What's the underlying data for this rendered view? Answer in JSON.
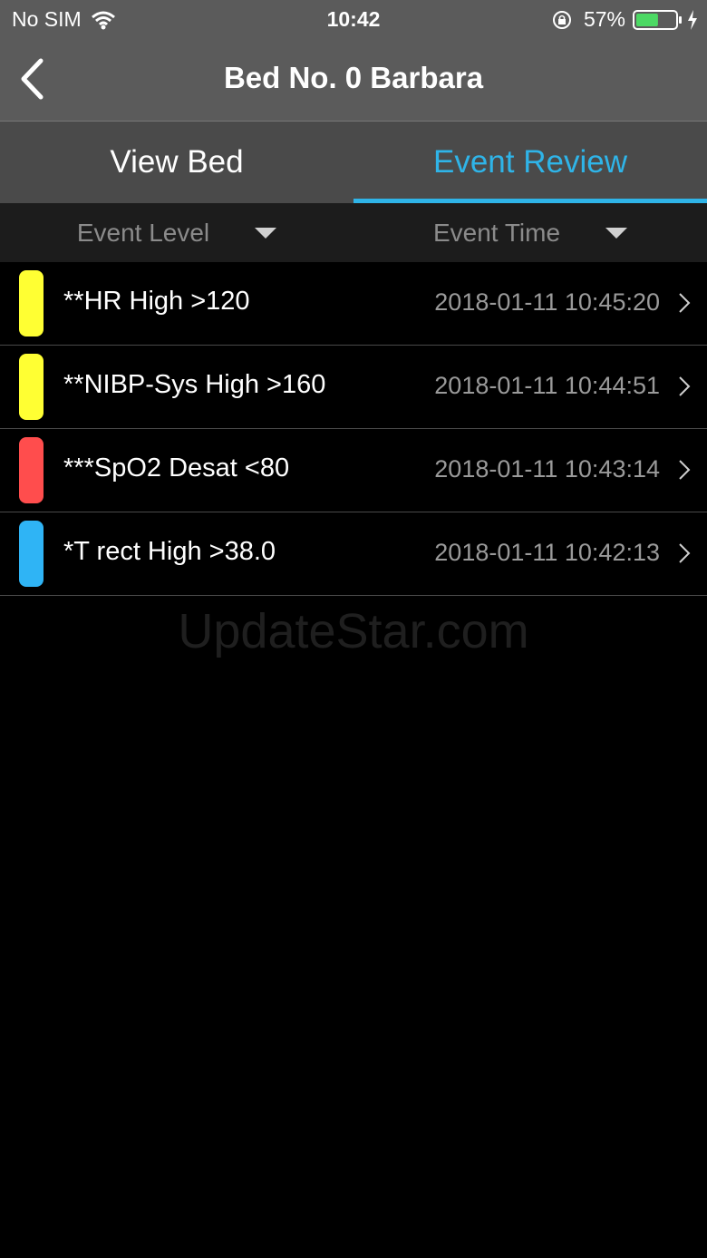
{
  "status_bar": {
    "carrier": "No SIM",
    "time": "10:42",
    "battery_percent": "57%",
    "battery_level": 0.57,
    "battery_color": "#4cd964"
  },
  "nav": {
    "title": "Bed No. 0 Barbara",
    "back_icon": "chevron-left-icon"
  },
  "tabs": [
    {
      "label": "View Bed",
      "active": false
    },
    {
      "label": "Event Review",
      "active": true
    }
  ],
  "filters": {
    "level_label": "Event Level",
    "time_label": "Event Time"
  },
  "events": [
    {
      "name": "**HR High >120",
      "time": "2018-01-11 10:45:20",
      "level_color": "#ffff33"
    },
    {
      "name": "**NIBP-Sys High >160",
      "time": "2018-01-11 10:44:51",
      "level_color": "#ffff33"
    },
    {
      "name": "***SpO2 Desat <80",
      "time": "2018-01-11 10:43:14",
      "level_color": "#ff4d4d"
    },
    {
      "name": "*T rect High >38.0",
      "time": "2018-01-11 10:42:13",
      "level_color": "#2fb4f5"
    }
  ],
  "watermark": "UpdateStar.com",
  "colors": {
    "accent": "#2fb4e8",
    "header_bg": "#5b5b5b",
    "tabs_bg": "#4a4a4a"
  }
}
